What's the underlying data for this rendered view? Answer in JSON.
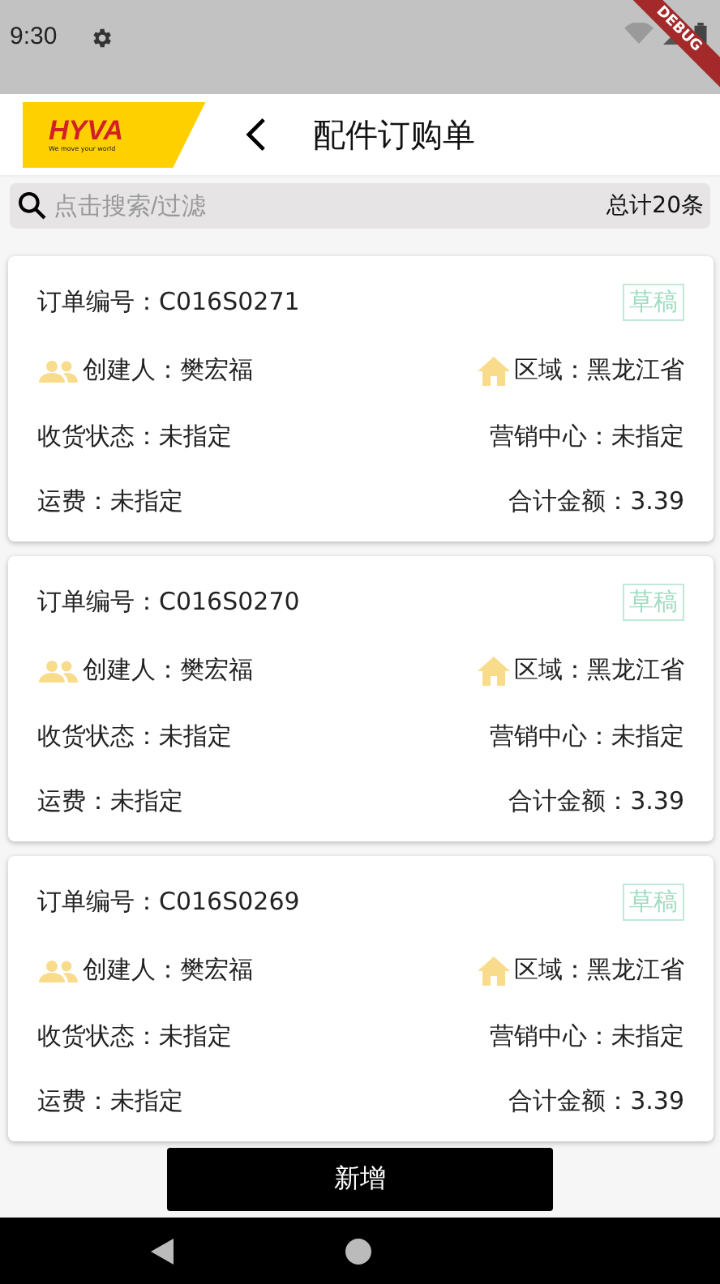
{
  "status_bar": {
    "time": "9:30"
  },
  "debug_banner": "DEBUG",
  "header": {
    "logo": {
      "name": "HYVA",
      "tagline": "We move your world"
    },
    "title": "配件订购单"
  },
  "search": {
    "placeholder": "点击搜索/过滤",
    "total": "总计20条"
  },
  "orders": [
    {
      "number": "订单编号：C016S0271",
      "status": "草稿",
      "creator": "创建人：樊宏福",
      "region": "区域：黑龙江省",
      "receipt_status": "收货状态：未指定",
      "marketing_center": "营销中心：未指定",
      "freight": "运费：未指定",
      "total": "合计金额：3.39"
    },
    {
      "number": "订单编号：C016S0270",
      "status": "草稿",
      "creator": "创建人：樊宏福",
      "region": "区域：黑龙江省",
      "receipt_status": "收货状态：未指定",
      "marketing_center": "营销中心：未指定",
      "freight": "运费：未指定",
      "total": "合计金额：3.39"
    },
    {
      "number": "订单编号：C016S0269",
      "status": "草稿",
      "creator": "创建人：樊宏福",
      "region": "区域：黑龙江省",
      "receipt_status": "收货状态：未指定",
      "marketing_center": "营销中心：未指定",
      "freight": "运费：未指定",
      "total": "合计金额：3.39"
    }
  ],
  "add_button": "新增"
}
